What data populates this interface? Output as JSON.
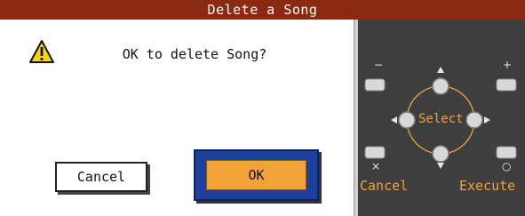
{
  "window": {
    "title": "Delete a Song"
  },
  "dialog": {
    "message": "OK to delete Song?",
    "cancel_label": "Cancel",
    "ok_label": "OK",
    "icon": "warning-icon"
  },
  "panel": {
    "minus_symbol": "−",
    "plus_symbol": "+",
    "cancel_symbol": "×",
    "execute_symbol": "○",
    "select_label": "Select",
    "cancel_label": "Cancel",
    "execute_label": "Execute"
  },
  "colors": {
    "title_bar": "#8b2a10",
    "ok_button": "#f3a23a",
    "ok_frame": "#1e3f9a",
    "panel_bg": "#3e3e3e",
    "panel_text": "#f3a23a"
  }
}
